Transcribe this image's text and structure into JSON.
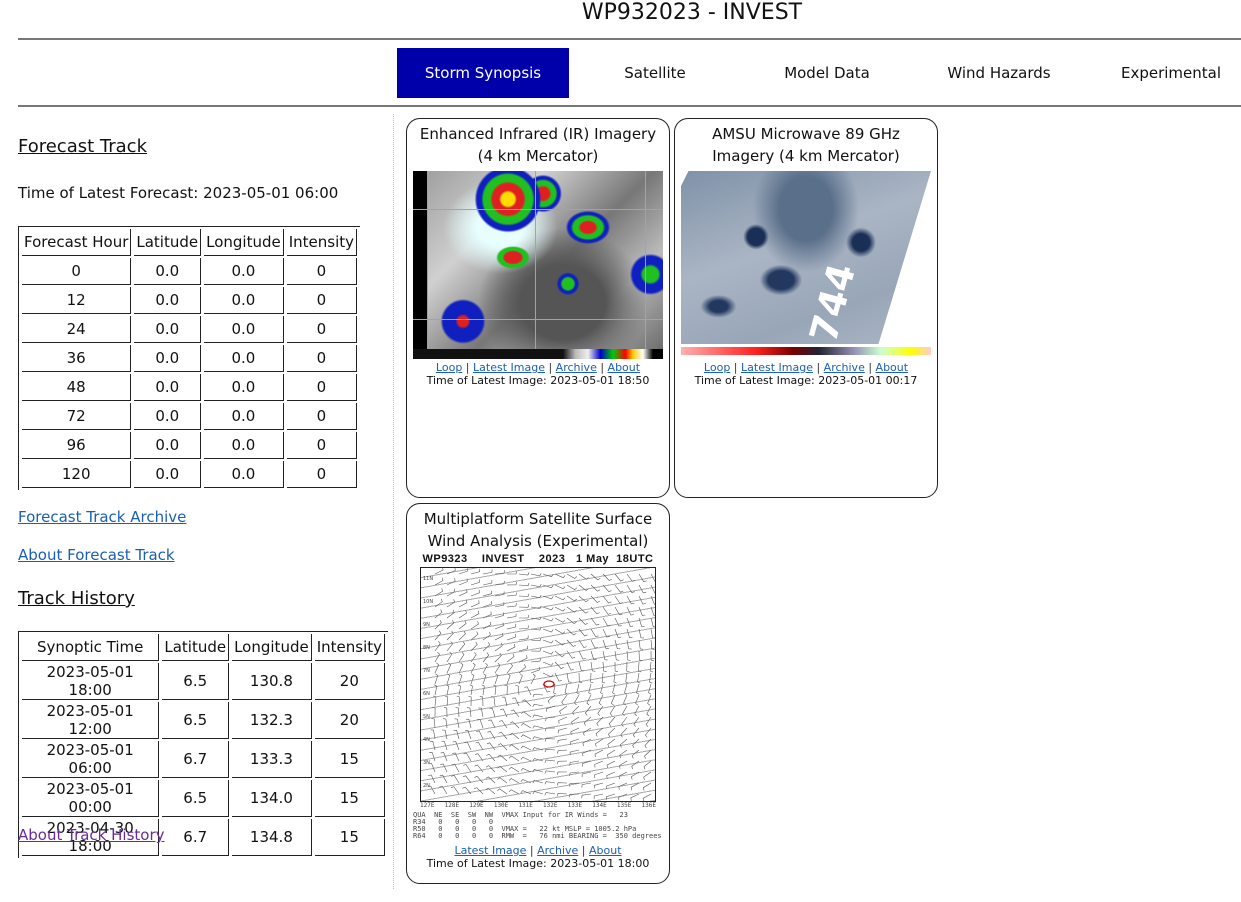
{
  "header": {
    "title": "WP932023 - INVEST"
  },
  "nav": {
    "tabs": [
      {
        "label": "Storm Synopsis",
        "active": true
      },
      {
        "label": "Satellite",
        "active": false
      },
      {
        "label": "Model Data",
        "active": false
      },
      {
        "label": "Wind Hazards",
        "active": false
      },
      {
        "label": "Experimental",
        "active": false
      }
    ],
    "active_color": "#0000aa"
  },
  "forecast_track": {
    "title": "Forecast Track",
    "latest_label": "Time of Latest Forecast: 2023-05-01 06:00",
    "columns": [
      "Forecast Hour",
      "Latitude",
      "Longitude",
      "Intensity"
    ],
    "rows": [
      [
        "0",
        "0.0",
        "0.0",
        "0"
      ],
      [
        "12",
        "0.0",
        "0.0",
        "0"
      ],
      [
        "24",
        "0.0",
        "0.0",
        "0"
      ],
      [
        "36",
        "0.0",
        "0.0",
        "0"
      ],
      [
        "48",
        "0.0",
        "0.0",
        "0"
      ],
      [
        "72",
        "0.0",
        "0.0",
        "0"
      ],
      [
        "96",
        "0.0",
        "0.0",
        "0"
      ],
      [
        "120",
        "0.0",
        "0.0",
        "0"
      ]
    ],
    "archive_link": "Forecast Track Archive",
    "about_link": "About Forecast Track"
  },
  "track_history": {
    "title": "Track History",
    "columns": [
      "Synoptic Time",
      "Latitude",
      "Longitude",
      "Intensity"
    ],
    "rows": [
      [
        "2023-05-01 18:00",
        "6.5",
        "130.8",
        "20"
      ],
      [
        "2023-05-01 12:00",
        "6.5",
        "132.3",
        "20"
      ],
      [
        "2023-05-01 06:00",
        "6.7",
        "133.3",
        "15"
      ],
      [
        "2023-05-01 00:00",
        "6.5",
        "134.0",
        "15"
      ],
      [
        "2023-04-30 18:00",
        "6.7",
        "134.8",
        "15"
      ]
    ],
    "about_link": "About Track History"
  },
  "cards": {
    "ir": {
      "title": "Enhanced Infrared (IR) Imagery (4 km Mercator)",
      "links": [
        "Loop",
        "Latest Image",
        "Archive",
        "About"
      ],
      "time": "Time of Latest Image: 2023-05-01 18:50"
    },
    "microwave": {
      "title": "AMSU Microwave 89 GHz Imagery (4 km Mercator)",
      "links": [
        "Loop",
        "Latest Image",
        "Archive",
        "About"
      ],
      "time": "Time of Latest Image: 2023-05-01 00:17",
      "overlay_text": "744"
    },
    "wind": {
      "title": "Multiplatform Satellite Surface Wind Analysis (Experimental)",
      "image_header": "WP9323    INVEST    2023   1 May  18UTC",
      "lat_labels": [
        "11N",
        "10N",
        "9N",
        "8N",
        "7N",
        "6N",
        "5N",
        "4N",
        "3N",
        "2N"
      ],
      "lon_labels": [
        "127E",
        "128E",
        "129E",
        "130E",
        "131E",
        "132E",
        "133E",
        "134E",
        "135E",
        "136E"
      ],
      "footer_lines": [
        "QUA  NE  SE  SW  NW  VMAX Input for IR Winds =   23",
        "R34   0   0   0   0",
        "R50   0   0   0   0  VMAX =   22 kt MSLP = 1005.2 hPa",
        "R64   0   0   0   0  RMW  =   76 nmi BEARING =  350 degrees"
      ],
      "links": [
        "Latest Image",
        "Archive",
        "About"
      ],
      "time": "Time of Latest Image: 2023-05-01 18:00"
    }
  }
}
